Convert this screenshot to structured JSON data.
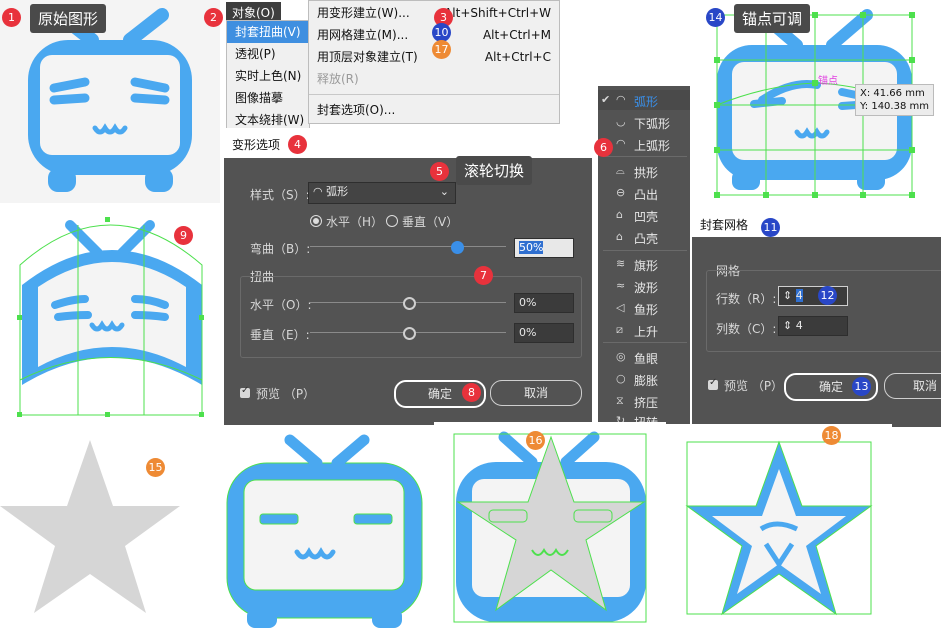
{
  "markers": {
    "m1": "1",
    "m2": "2",
    "m3": "3",
    "m4": "4",
    "m5": "5",
    "m6": "6",
    "m7": "7",
    "m8": "8",
    "m9": "9",
    "m10": "10",
    "m11": "11",
    "m12": "12",
    "m13": "13",
    "m14": "14",
    "m15": "15",
    "m16": "16",
    "m17": "17",
    "m18": "18"
  },
  "callouts": {
    "original": "原始图形",
    "scroll": "滚轮切换",
    "anchor_adjust": "锚点可调"
  },
  "menubar": {
    "object": "对象(O)"
  },
  "envelope_menu": {
    "trigger": "封套扭曲(V)",
    "items": [
      "透视(P)",
      "实时上色(N)",
      "图像描摹",
      "文本绕排(W)"
    ]
  },
  "envelope_submenu": {
    "warp": {
      "label": "用变形建立(W)...",
      "shortcut": "Alt+Shift+Ctrl+W"
    },
    "mesh": {
      "label": "用网格建立(M)...",
      "shortcut": "Alt+Ctrl+M"
    },
    "top": {
      "label": "用顶层对象建立(T)",
      "shortcut": "Alt+Ctrl+C"
    },
    "release": "释放(R)",
    "options": "封套选项(O)..."
  },
  "warp_dialog": {
    "title": "变形选项",
    "style_label": "样式（S）:",
    "style_value": "弧形",
    "horizontal": "水平（H）",
    "vertical": "垂直（V）",
    "bend_label": "弯曲（B）:",
    "bend_value": "50%",
    "distort_label": "扭曲",
    "h_label": "水平（O）:",
    "h_value": "0%",
    "v_label": "垂直（E）:",
    "v_value": "0%",
    "preview": "预览 （P）",
    "ok": "确定",
    "cancel": "取消"
  },
  "style_list": {
    "items": [
      "弧形",
      "下弧形",
      "上弧形",
      "拱形",
      "凸出",
      "凹壳",
      "凸壳",
      "旗形",
      "波形",
      "鱼形",
      "上升",
      "鱼眼",
      "膨胀",
      "挤压",
      "扭转"
    ]
  },
  "mesh_dialog": {
    "title": "封套网格",
    "group": "网格",
    "rows_label": "行数（R）:",
    "rows_value": "4",
    "cols_label": "列数（C）:",
    "cols_value": "4",
    "preview": "预览 （P）",
    "ok": "确定",
    "cancel": "取消"
  },
  "anchor_info": {
    "tag": "锚点",
    "x": "X: 41.66 mm",
    "y": "Y: 140.38 mm"
  },
  "colors": {
    "tv_blue": "#4aa8f0",
    "star_gray": "#d6d6d6",
    "guide_green": "#4de04d",
    "dialog_bg": "#535353"
  }
}
